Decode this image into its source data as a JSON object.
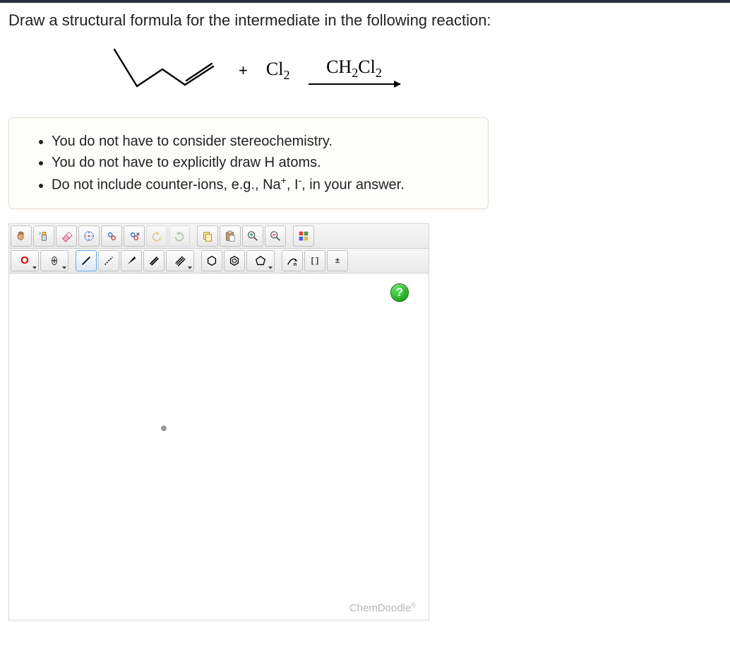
{
  "prompt": "Draw a structural formula for the intermediate in the following reaction:",
  "reaction": {
    "plus": "+",
    "reagent": "Cl",
    "reagent_sub": "2",
    "arrow_top_a": "CH",
    "arrow_top_a_sub": "2",
    "arrow_top_b": "Cl",
    "arrow_top_b_sub": "2"
  },
  "hints": {
    "h1": "You do not have to consider stereochemistry.",
    "h2": "You do not have to explicitly draw H atoms.",
    "h3_pre": "Do not include counter-ions, e.g., Na",
    "h3_sup1": "+",
    "h3_mid": ", I",
    "h3_sup2": "-",
    "h3_post": ", in your answer."
  },
  "toolbar1": {
    "hand": "hand",
    "spray": "spray",
    "eraser": "eraser",
    "center": "center",
    "rings1": "rings",
    "rings2": "rings2",
    "undo": "undo",
    "redo": "redo",
    "copy": "copy",
    "paste": "paste",
    "zoomin": "zoom-in",
    "zoomout": "zoom-out",
    "colors": "colors"
  },
  "toolbar2": {
    "oxy": "O",
    "plus": "+",
    "single": "single",
    "dashed": "dashed",
    "wedge": "wedge",
    "dbl": "double",
    "trip": "triple",
    "hex": "hexagon",
    "benz": "benzene",
    "pent": "pentagon",
    "curve": "curve",
    "n": "n",
    "brackets": "[ ]",
    "charge": "±"
  },
  "canvas": {
    "help": "?",
    "brand": "ChemDoodle",
    "reg": "®"
  }
}
